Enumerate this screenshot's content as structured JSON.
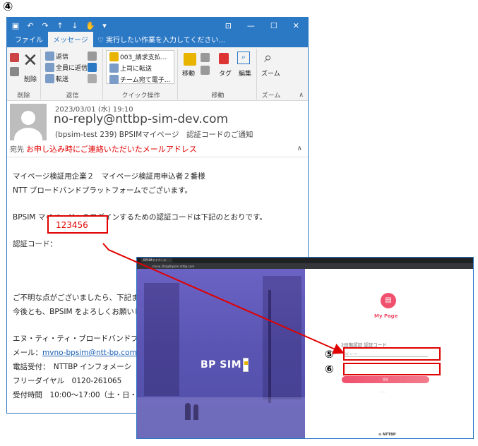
{
  "step_marker": "④",
  "outlook": {
    "tabs": [
      "ファイル",
      "メッセージ"
    ],
    "tell_me": "実行したい作業を入力してください...",
    "ribbon": {
      "delete": {
        "label": "削除",
        "group": "削除"
      },
      "respond": {
        "reply": "返信",
        "reply_all": "全員に返信",
        "forward": "転送",
        "group": "返信"
      },
      "quick_steps": {
        "items": [
          "003_請求支払...",
          "上司に転送",
          "チーム宛て電子..."
        ],
        "group": "クイック操作"
      },
      "move": {
        "move": "移動",
        "tags": "タグ",
        "edit": "編集",
        "zoom": "ズーム",
        "group": "移動",
        "zoom_group": "ズーム"
      }
    },
    "message": {
      "date": "2023/03/01 (水) 19:10",
      "from": "no-reply@nttbp-sim-dev.com",
      "subject": "(bpsim-test 239) BPSIMマイページ　認証コードのご通知",
      "to_label": "宛先",
      "to_value": "お申し込み時にご連絡いただいたメールアドレス",
      "body": {
        "l1": "マイページ検証用企業２　マイページ検証用申込者２番様",
        "l2": "NTT ブロードバンドプラットフォームでございます。",
        "l3": "BPSIM マイページへのログインするための認証コードは下記のとおりです。",
        "code_label": "認証コード：",
        "code_value": "123456",
        "l4": "ご不明な点がございましたら、下記ま",
        "l5": "今後とも、BPSIM をよろしくお願いし",
        "l6": "エヌ・ティ・ティ・ブロードバンドプ",
        "mail_label": "メール：",
        "mail_link": "mvno-bpsim@ntt-bp.com",
        "phone": "電話受付：　NTTBP インフォメーシ",
        "free": "フリーダイヤル　0120-261065",
        "hours": "受付時間　10:00～17:00（土・日・祝"
      }
    }
  },
  "browser": {
    "tab_title": "BPSIMマイページ",
    "url": "mvno.2fa/ghbpsim.nttbp.com",
    "logo": "BP SIM",
    "mypage": "My Page",
    "tfa_title": "2段階認証 認証コード",
    "code_placeholder": "認証コード",
    "button": "認証",
    "footer_brand": "NTTBP"
  },
  "markers": {
    "five": "⑤",
    "six": "⑥"
  },
  "colors": {
    "outlook_blue": "#2b78c5",
    "highlight_red": "#e00000",
    "accent_pink": "#f0506e"
  }
}
